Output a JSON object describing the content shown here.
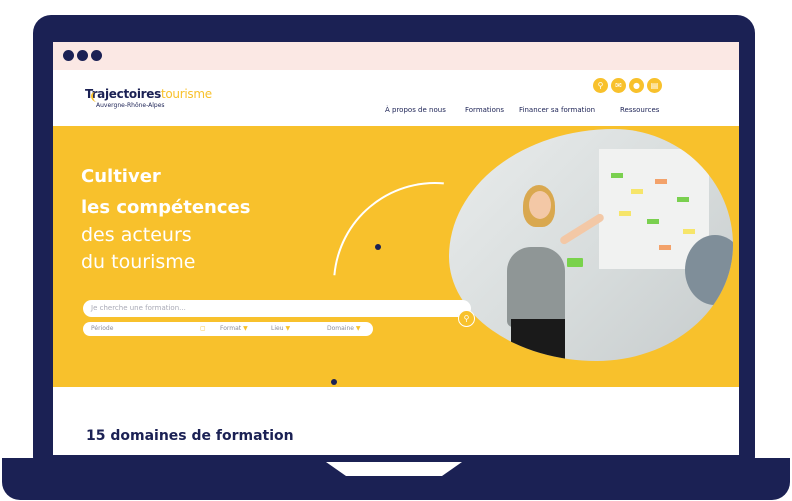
{
  "logo": {
    "name_part1": "Trajectoires",
    "name_part2": "tourisme",
    "region": "Auvergne-Rhône-Alpes"
  },
  "header_icons": [
    "search-icon",
    "mail-icon",
    "user-icon",
    "calendar-icon"
  ],
  "nav": {
    "items": [
      "À propos de nous",
      "Formations",
      "Financer sa formation",
      "Ressources"
    ]
  },
  "hero": {
    "line1": "Cultiver",
    "line2": "les compétences",
    "line3": "des acteurs",
    "line4": "du tourisme"
  },
  "search": {
    "placeholder": "Je cherche une formation..."
  },
  "filters": {
    "period": "Période",
    "format": "Format",
    "place": "Lieu",
    "domain": "Domaine"
  },
  "section": {
    "title": "15 domaines de formation"
  },
  "colors": {
    "brand_yellow": "#f8c12c",
    "navy": "#1b2154",
    "browser_bar": "#fbe8e4"
  }
}
